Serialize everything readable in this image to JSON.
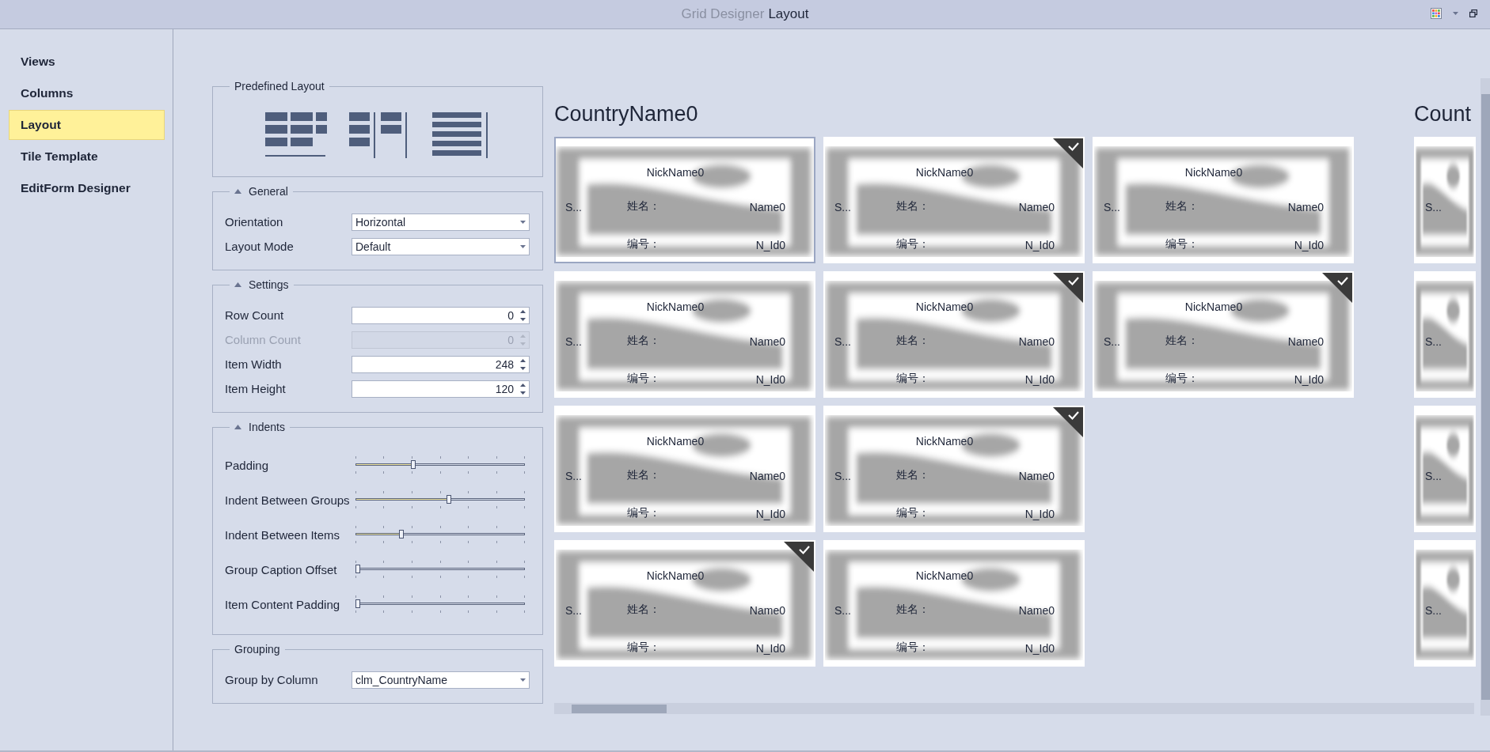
{
  "window": {
    "title_app": "Grid Designer",
    "title_page": "Layout"
  },
  "sidebar": {
    "items": [
      {
        "label": "Views",
        "selected": false
      },
      {
        "label": "Columns",
        "selected": false
      },
      {
        "label": "Layout",
        "selected": true
      },
      {
        "label": "Tile Template",
        "selected": false
      },
      {
        "label": "EditForm Designer",
        "selected": false
      }
    ]
  },
  "predefined_layout": {
    "caption": "Predefined Layout",
    "options": [
      {
        "kind": "grid"
      },
      {
        "kind": "columns"
      },
      {
        "kind": "list"
      }
    ]
  },
  "general": {
    "caption": "General",
    "expanded": true,
    "fields": [
      {
        "label": "Orientation",
        "value": "Horizontal"
      },
      {
        "label": "Layout Mode",
        "value": "Default"
      }
    ]
  },
  "settings": {
    "caption": "Settings",
    "expanded": true,
    "fields": [
      {
        "label": "Row Count",
        "value": "0",
        "disabled": false
      },
      {
        "label": "Column Count",
        "value": "0",
        "disabled": true
      },
      {
        "label": "Item Width",
        "value": "248",
        "disabled": false
      },
      {
        "label": "Item Height",
        "value": "120",
        "disabled": false
      }
    ]
  },
  "indents": {
    "caption": "Indents",
    "expanded": true,
    "sliders": [
      {
        "label": "Padding",
        "level": 0.34
      },
      {
        "label": "Indent Between Groups",
        "level": 0.55
      },
      {
        "label": "Indent Between Items",
        "level": 0.27
      },
      {
        "label": "Group Caption Offset",
        "level": 0
      },
      {
        "label": "Item Content Padding",
        "level": 0
      }
    ]
  },
  "grouping": {
    "caption": "Grouping",
    "fields": [
      {
        "label": "Group by Column",
        "value": "clm_CountryName"
      }
    ]
  },
  "tile_view": {
    "groups": [
      {
        "caption": "CountryName0",
        "partial": false,
        "tiles": [
          {
            "nickname": "NickName0",
            "side": "S...",
            "name_label": "姓名：",
            "name": "Name0",
            "id_label": "编号：",
            "id": "N_Id0",
            "checked": false,
            "focused": true
          },
          {
            "nickname": "NickName0",
            "side": "S...",
            "name_label": "姓名：",
            "name": "Name0",
            "id_label": "编号：",
            "id": "N_Id0",
            "checked": false,
            "focused": false
          },
          {
            "nickname": "NickName0",
            "side": "S...",
            "name_label": "姓名：",
            "name": "Name0",
            "id_label": "编号：",
            "id": "N_Id0",
            "checked": false,
            "focused": false
          },
          {
            "nickname": "NickName0",
            "side": "S...",
            "name_label": "姓名：",
            "name": "Name0",
            "id_label": "编号：",
            "id": "N_Id0",
            "checked": true,
            "focused": false
          },
          {
            "nickname": "NickName0",
            "side": "S...",
            "name_label": "姓名：",
            "name": "Name0",
            "id_label": "编号：",
            "id": "N_Id0",
            "checked": true,
            "focused": false
          },
          {
            "nickname": "NickName0",
            "side": "S...",
            "name_label": "姓名：",
            "name": "Name0",
            "id_label": "编号：",
            "id": "N_Id0",
            "checked": true,
            "focused": false
          },
          {
            "nickname": "NickName0",
            "side": "S...",
            "name_label": "姓名：",
            "name": "Name0",
            "id_label": "编号：",
            "id": "N_Id0",
            "checked": true,
            "focused": false
          },
          {
            "nickname": "NickName0",
            "side": "S...",
            "name_label": "姓名：",
            "name": "Name0",
            "id_label": "编号：",
            "id": "N_Id0",
            "checked": false,
            "focused": false
          },
          {
            "nickname": "NickName0",
            "side": "S...",
            "name_label": "姓名：",
            "name": "Name0",
            "id_label": "编号：",
            "id": "N_Id0",
            "checked": false,
            "focused": false
          },
          {
            "nickname": "NickName0",
            "side": "S...",
            "name_label": "姓名：",
            "name": "Name0",
            "id_label": "编号：",
            "id": "N_Id0",
            "checked": true,
            "focused": false
          }
        ]
      },
      {
        "caption": "Count",
        "partial": true,
        "tiles": [
          {
            "side": "S..."
          },
          {
            "side": "S..."
          },
          {
            "side": "S..."
          },
          {
            "side": "S..."
          }
        ]
      }
    ]
  }
}
